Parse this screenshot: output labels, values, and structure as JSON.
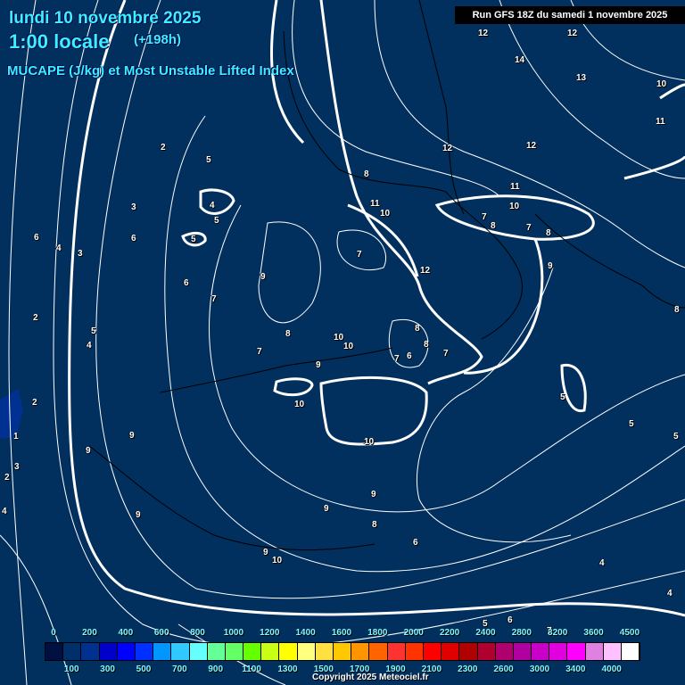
{
  "header": {
    "date": "lundi 10 novembre 2025",
    "local_time": "1:00 locale",
    "lead_time": "(+198h)",
    "parameter": "MUCAPE (J/kg) et Most Unstable Lifted Index",
    "run": "Run GFS 18Z du samedi 1 novembre 2025"
  },
  "legend": {
    "colors": [
      "#001040",
      "#00306a",
      "#003090",
      "#0000c8",
      "#0000ff",
      "#0030ff",
      "#0096ff",
      "#30c8ff",
      "#64ffff",
      "#64ff96",
      "#64ff64",
      "#64ff00",
      "#c8ff14",
      "#ffff00",
      "#ffff80",
      "#ffe040",
      "#ffc800",
      "#ff9600",
      "#ff6400",
      "#ff3232",
      "#ff3200",
      "#ff0000",
      "#e00000",
      "#b00000",
      "#b00030",
      "#b00070",
      "#b000a0",
      "#c800c8",
      "#e000e0",
      "#ff00ff",
      "#e080e0",
      "#ffc0ff",
      "#ffffff"
    ],
    "top_labels": [
      "0",
      "200",
      "400",
      "600",
      "800",
      "1000",
      "1200",
      "1400",
      "1600",
      "1800",
      "2000",
      "2200",
      "2400",
      "2800",
      "3200",
      "3600",
      "4500"
    ],
    "bottom_labels": [
      "100",
      "300",
      "500",
      "700",
      "900",
      "1100",
      "1300",
      "1500",
      "1700",
      "1900",
      "2100",
      "2300",
      "2600",
      "3000",
      "3400",
      "4000"
    ]
  },
  "contour_labels": [
    "12",
    "12",
    "14",
    "13",
    "10",
    "11",
    "12",
    "12",
    "11",
    "10",
    "7",
    "8",
    "7",
    "8",
    "9",
    "9",
    "8",
    "7",
    "12",
    "11",
    "10",
    "5",
    "4",
    "5",
    "6",
    "4",
    "3",
    "3",
    "6",
    "5",
    "6",
    "2",
    "4",
    "5",
    "7",
    "9",
    "8",
    "7",
    "10",
    "10",
    "9",
    "7",
    "6",
    "8",
    "7",
    "8",
    "5",
    "10",
    "10",
    "9",
    "9",
    "8",
    "9",
    "9",
    "9",
    "10",
    "6",
    "4",
    "4",
    "5",
    "6",
    "7",
    "5",
    "8",
    "2",
    "1",
    "3",
    "2",
    "4",
    "2",
    "5"
  ],
  "copyright": "Copyright 2025 Meteociel.fr"
}
